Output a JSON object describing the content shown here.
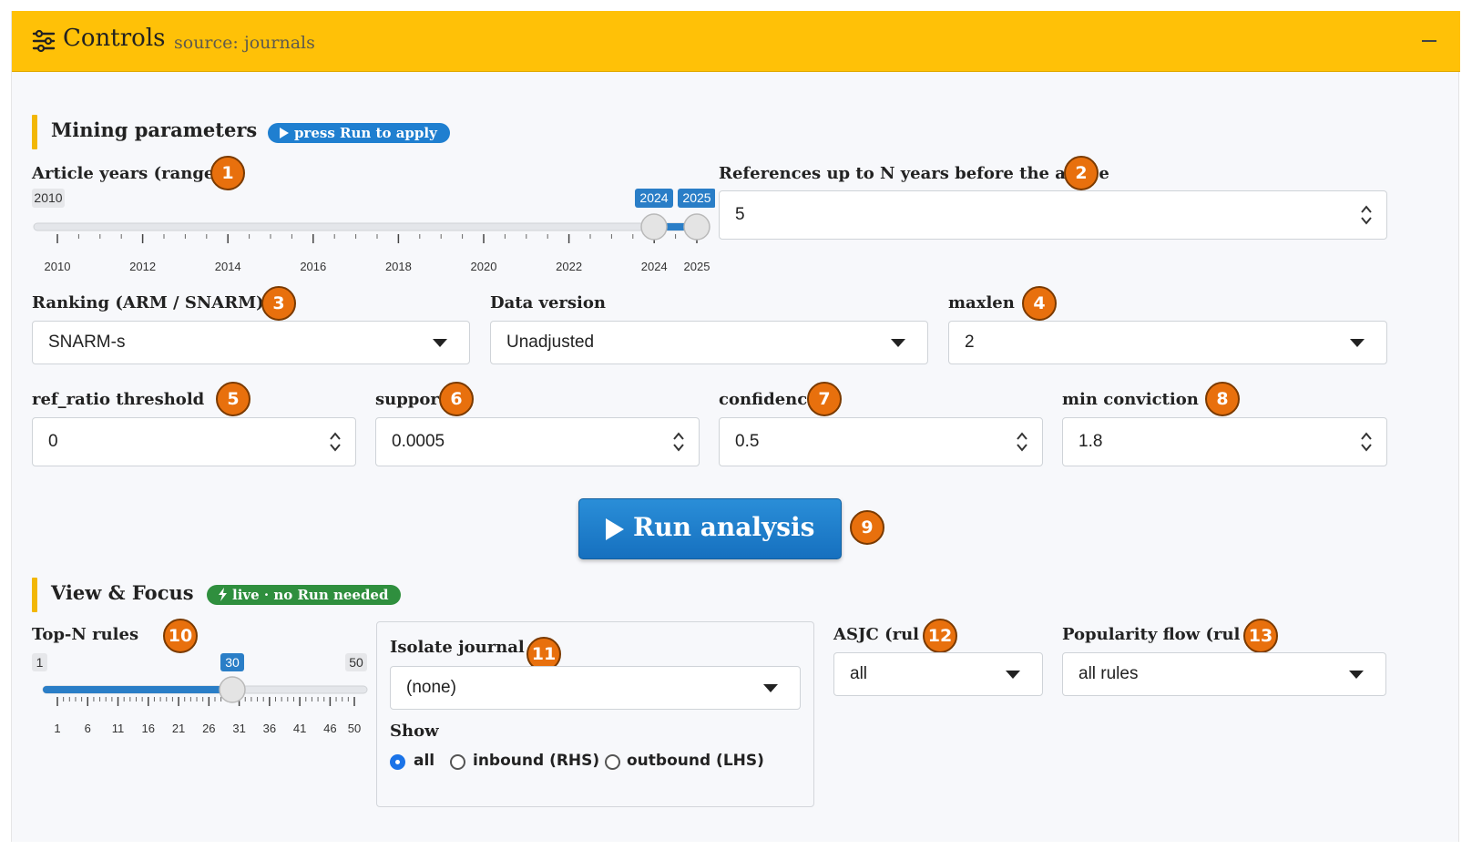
{
  "header": {
    "title": "Controls",
    "source": "source: journals",
    "color": "#ffc107"
  },
  "mining": {
    "title": "Mining parameters",
    "pill": "press Run to apply",
    "article_years": {
      "label": "Article years (range",
      "badge": "1",
      "min_label": "2010",
      "from": "2024",
      "to": "2025",
      "ticks": [
        "2010",
        "2012",
        "2014",
        "2016",
        "2018",
        "2020",
        "2022",
        "2024",
        "2025"
      ]
    },
    "references": {
      "label_part1": "References up to N years before the ar",
      "label_part2": "e",
      "badge": "2",
      "value": "5"
    },
    "ranking": {
      "label": "Ranking (ARM / SNARM)",
      "badge": "3",
      "value": "SNARM-s"
    },
    "data_version": {
      "label": "Data version",
      "value": "Unadjusted"
    },
    "maxlen": {
      "label": "maxlen",
      "badge": "4",
      "value": "2"
    },
    "ref_ratio": {
      "label": "ref_ratio threshold",
      "badge": "5",
      "value": "0"
    },
    "support": {
      "label": "suppor",
      "badge": "6",
      "value": "0.0005"
    },
    "confidence": {
      "label": "confidenc",
      "badge": "7",
      "value": "0.5"
    },
    "min_conviction": {
      "label": "min conviction",
      "badge": "8",
      "value": "1.8"
    }
  },
  "run": {
    "label": "Run analysis",
    "badge": "9"
  },
  "view": {
    "title": "View & Focus",
    "pill": "live · no Run needed",
    "topn": {
      "label": "Top-N rules",
      "badge": "10",
      "min_label": "1",
      "max_label": "50",
      "value": "30",
      "ticks": [
        "1",
        "6",
        "11",
        "16",
        "21",
        "26",
        "31",
        "36",
        "41",
        "46",
        "50"
      ]
    },
    "isolate": {
      "label": "Isolate journal",
      "badge": "11",
      "value": "(none)",
      "show_label": "Show",
      "options": [
        "all",
        "inbound (RHS)",
        "outbound (LHS)"
      ],
      "selected": "all"
    },
    "asjc": {
      "label": "ASJC (rul",
      "badge": "12",
      "value": "all"
    },
    "popularity": {
      "label": "Popularity flow (rul",
      "badge": "13",
      "value": "all rules"
    }
  }
}
